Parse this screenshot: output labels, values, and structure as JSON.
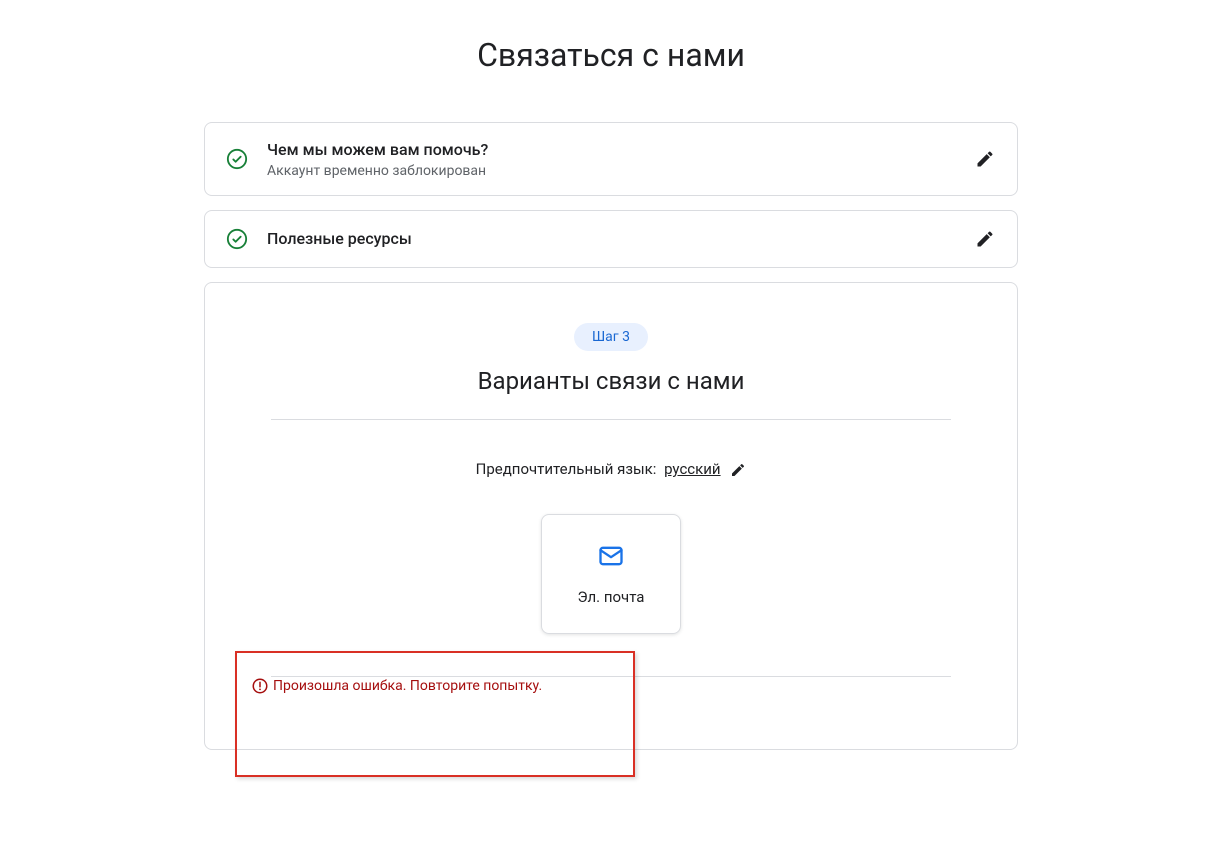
{
  "page": {
    "title": "Связаться с нами"
  },
  "steps": {
    "step1": {
      "title": "Чем мы можем вам помочь?",
      "subtitle": "Аккаунт временно заблокирован"
    },
    "step2": {
      "title": "Полезные ресурсы"
    }
  },
  "step3": {
    "badge": "Шаг 3",
    "heading": "Варианты связи с нами",
    "language_label": "Предпочтительный язык:",
    "language_value": "русский",
    "option_email": "Эл. почта",
    "error_message": "Произошла ошибка. Повторите попытку."
  }
}
